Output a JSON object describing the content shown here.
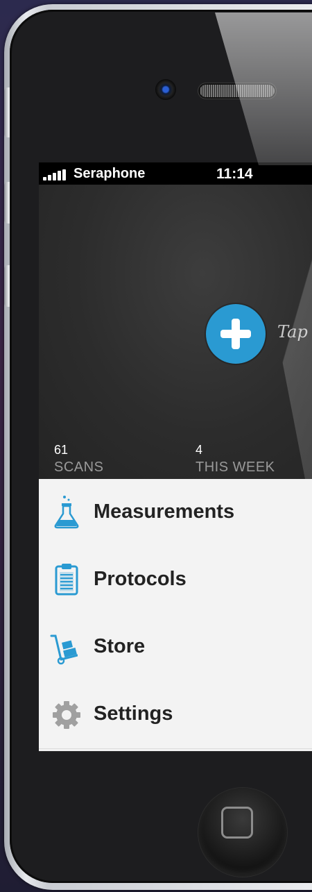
{
  "status_bar": {
    "carrier": "Seraphone",
    "time": "11:14"
  },
  "hero": {
    "add_hint": "Tap",
    "stats": [
      {
        "value": "61",
        "label": "SCANS"
      },
      {
        "value": "4",
        "label": "THIS WEEK"
      }
    ]
  },
  "menu": {
    "items": [
      {
        "label": "Measurements",
        "icon": "flask-icon"
      },
      {
        "label": "Protocols",
        "icon": "clipboard-icon"
      },
      {
        "label": "Store",
        "icon": "hand-truck-icon"
      },
      {
        "label": "Settings",
        "icon": "gear-icon"
      }
    ]
  },
  "colors": {
    "accent": "#2a9ad2",
    "menu_bg": "#f3f3f3",
    "screen_bg": "#272727"
  }
}
